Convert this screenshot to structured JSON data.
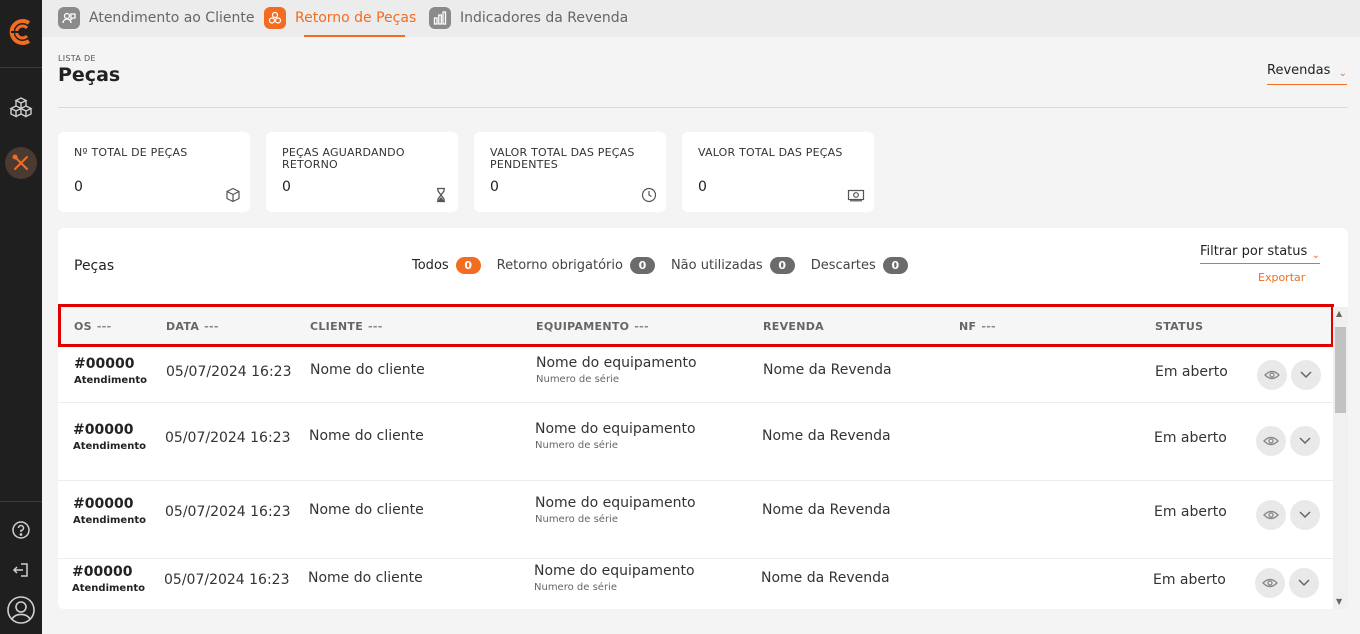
{
  "app": {
    "accent_color": "#f26c21",
    "sidebar_color": "#1f1f1f"
  },
  "sidebar": {
    "logo_icon": "brand-c-logo",
    "items": [
      {
        "icon": "cubes-icon",
        "active": false
      },
      {
        "icon": "tools-icon",
        "active": true
      }
    ],
    "bottom": [
      {
        "icon": "help-icon"
      },
      {
        "icon": "logout-icon"
      },
      {
        "icon": "user-avatar-icon"
      }
    ]
  },
  "tabs": [
    {
      "label": "Atendimento ao Cliente",
      "icon": "customer-service-icon",
      "active": false
    },
    {
      "label": "Retorno de Peças",
      "icon": "parts-icon",
      "active": true
    },
    {
      "label": "Indicadores da Revenda",
      "icon": "bar-chart-icon",
      "active": false
    }
  ],
  "header": {
    "eyebrow": "LISTA DE",
    "title": "Peças",
    "dealer_select": "Revendas"
  },
  "cards": [
    {
      "label": "Nº TOTAL DE PEÇAS",
      "value": "0",
      "icon": "cube-icon"
    },
    {
      "label": "PEÇAS AGUARDANDO RETORNO",
      "value": "0",
      "icon": "hourglass-icon"
    },
    {
      "label": "VALOR TOTAL DAS PEÇAS PENDENTES",
      "value": "0",
      "icon": "clock-icon"
    },
    {
      "label": "VALOR TOTAL DAS PEÇAS",
      "value": "0",
      "icon": "money-icon"
    }
  ],
  "table": {
    "title": "Peças",
    "filters": [
      {
        "label": "Todos",
        "count": "0",
        "active": true
      },
      {
        "label": "Retorno obrigatório",
        "count": "0",
        "active": false
      },
      {
        "label": "Não utilizadas",
        "count": "0",
        "active": false
      },
      {
        "label": "Descartes",
        "count": "0",
        "active": false
      }
    ],
    "status_filter": "Filtrar por status",
    "export_label": "Exportar",
    "columns": [
      {
        "label": "OS",
        "dots": "---"
      },
      {
        "label": "DATA",
        "dots": "---"
      },
      {
        "label": "CLIENTE",
        "dots": "---"
      },
      {
        "label": "EQUIPAMENTO",
        "dots": "---"
      },
      {
        "label": "REVENDA",
        "dots": ""
      },
      {
        "label": "NF",
        "dots": "---"
      },
      {
        "label": "STATUS",
        "dots": ""
      }
    ],
    "rows": [
      {
        "os": "#00000",
        "os_type": "Atendimento",
        "date": "05/07/2024 16:23",
        "client": "Nome do cliente",
        "equipment": "Nome do equipamento",
        "serial": "Numero de série",
        "dealer": "Nome da Revenda",
        "nf": "",
        "status": "Em aberto"
      },
      {
        "os": "#00000",
        "os_type": "Atendimento",
        "date": "05/07/2024 16:23",
        "client": "Nome do cliente",
        "equipment": "Nome do equipamento",
        "serial": "Numero de série",
        "dealer": "Nome da Revenda",
        "nf": "",
        "status": "Em aberto"
      },
      {
        "os": "#00000",
        "os_type": "Atendimento",
        "date": "05/07/2024 16:23",
        "client": "Nome do cliente",
        "equipment": "Nome do equipamento",
        "serial": "Numero de série",
        "dealer": "Nome da Revenda",
        "nf": "",
        "status": "Em aberto"
      },
      {
        "os": "#00000",
        "os_type": "Atendimento",
        "date": "05/07/2024 16:23",
        "client": "Nome do cliente",
        "equipment": "Nome do equipamento",
        "serial": "Numero de série",
        "dealer": "Nome da Revenda",
        "nf": "",
        "status": "Em aberto"
      }
    ],
    "row_actions": [
      "eye-icon",
      "chevron-down-icon"
    ]
  }
}
